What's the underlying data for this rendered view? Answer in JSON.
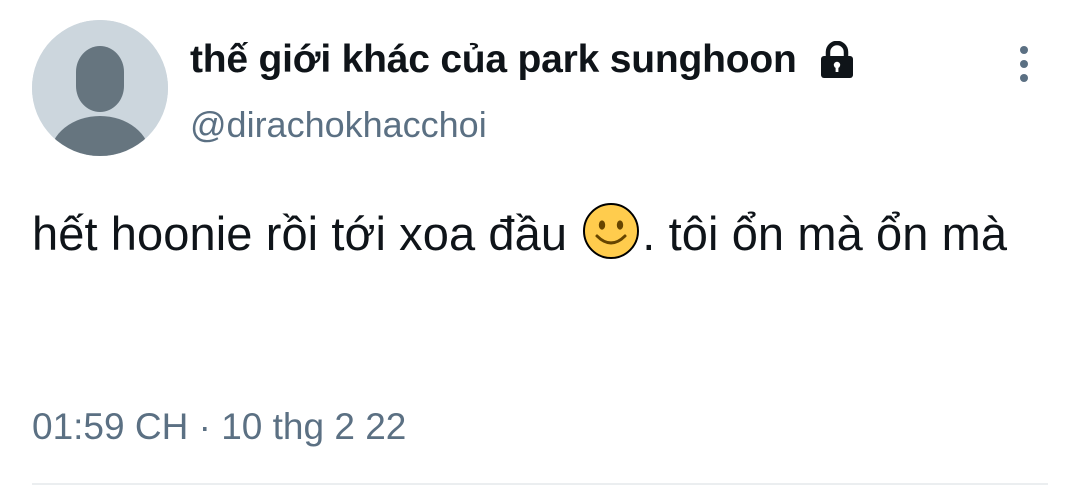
{
  "tweet": {
    "display_name": "thế giới khác của park sunghoon",
    "handle": "@dirachokhacchoi",
    "text_before_emoji": "hết hoonie rồi tới xoa đầu ",
    "emoji": "slightly-smiling-face-emoji",
    "text_after_emoji": ". tôi ổn mà ổn mà",
    "time": "01:59 CH",
    "separator": "·",
    "date": "10 thg 2 22"
  },
  "icons": {
    "account_lock": "lock-icon",
    "more_options": "more-vertical-icon",
    "avatar_placeholder": "default-avatar-icon"
  },
  "colors": {
    "avatar_bg": "#ccd6dd",
    "avatar_figure": "#66757f",
    "secondary_text": "#5b7083",
    "primary_text": "#0f1419",
    "emoji_face": "#ffcc4d",
    "divider": "#ebeef0"
  }
}
